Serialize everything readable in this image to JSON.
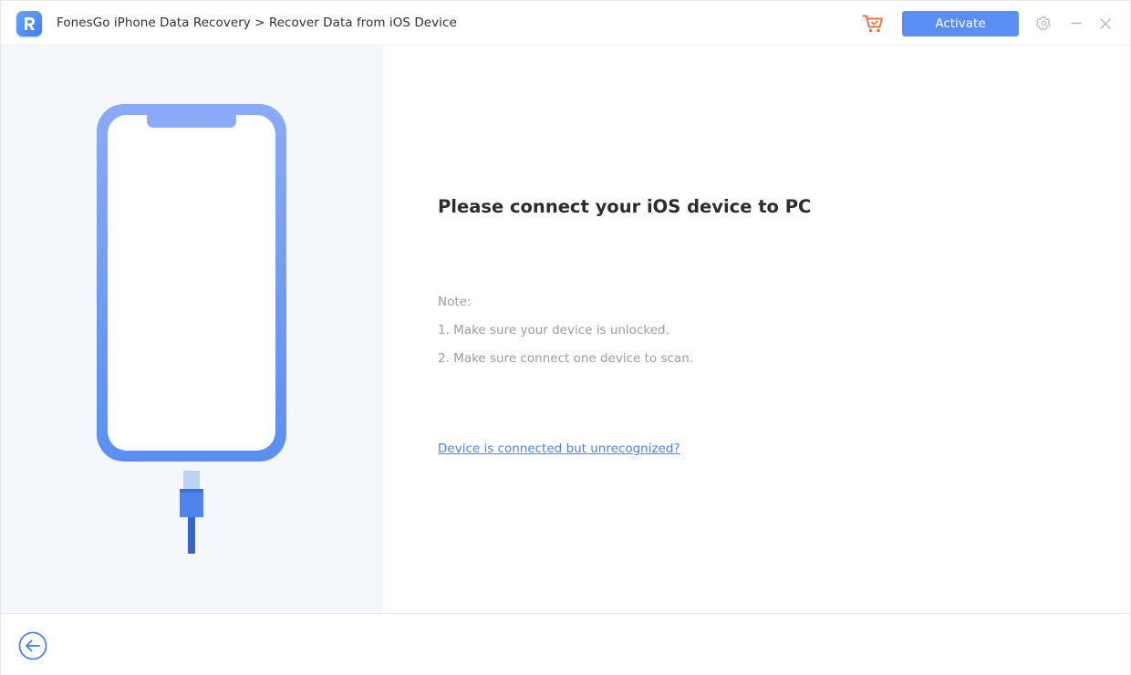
{
  "titlebar": {
    "title": "FonesGo iPhone Data Recovery > Recover Data from iOS Device",
    "activate_label": "Activate",
    "icons": {
      "logo": "app-logo-r",
      "cart": "cart-icon",
      "settings": "gear-icon",
      "minimize": "minimize-icon",
      "close": "close-icon"
    }
  },
  "main": {
    "title": "Please connect your iOS device to PC",
    "note_label": "Note:",
    "notes": [
      "1. Make sure your device is unlocked.",
      "2. Make sure connect one device to scan."
    ],
    "help_link": "Device is connected but unrecognized?"
  },
  "footer": {
    "back_icon": "arrow-left-circle-icon"
  },
  "colors": {
    "accent": "#5b8ef5",
    "link": "#4a86ea",
    "cart": "#f07040",
    "phone_top": "#8aaaf8",
    "phone_bottom": "#5a8ff2",
    "left_panel_bg": "#f4f7fb"
  }
}
